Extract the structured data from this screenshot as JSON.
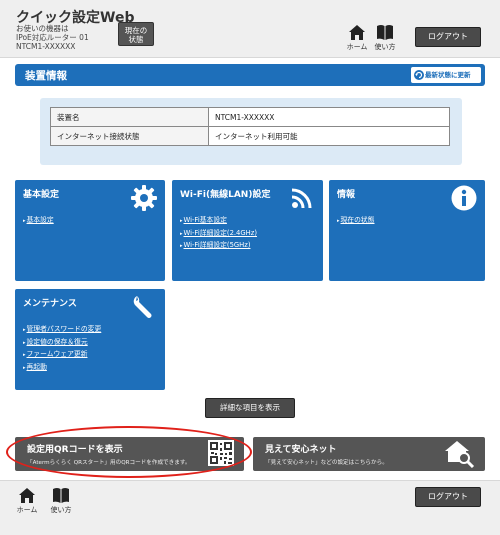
{
  "header": {
    "app_title": "クイック設定Web",
    "device_line1": "お使いの機器は",
    "device_line2": "IPoE対応ルーター 01",
    "device_line3": "NTCM1-XXXXXX",
    "status_button_line1": "現在の",
    "status_button_line2": "状態",
    "home_label": "ホーム",
    "help_label": "使い方",
    "logout_label": "ログアウト"
  },
  "device_info": {
    "title": "装置情報",
    "refresh_label": "最新状態に更新",
    "rows": [
      {
        "key": "装置名",
        "value": "NTCM1-XXXXXX"
      },
      {
        "key": "インターネット接続状態",
        "value": "インターネット利用可能"
      }
    ]
  },
  "tiles": {
    "basic": {
      "title": "基本設定",
      "icon": "gear-icon",
      "links": [
        "基本設定"
      ]
    },
    "wifi": {
      "title": "Wi-Fi(無線LAN)設定",
      "icon": "wifi-icon",
      "links": [
        "Wi-Fi基本設定",
        "Wi-Fi詳細設定(2.4GHz)",
        "Wi-Fi詳細設定(5GHz)"
      ]
    },
    "info": {
      "title": "情報",
      "icon": "info-icon",
      "links": [
        "現在の状態"
      ]
    },
    "maintenance": {
      "title": "メンテナンス",
      "icon": "wrench-icon",
      "links": [
        "管理者パスワードの変更",
        "設定値の保存＆復元",
        "ファームウェア更新",
        "再起動"
      ]
    }
  },
  "detail_button_label": "詳細な項目を表示",
  "banners": {
    "qr": {
      "title": "設定用QRコードを表示",
      "desc": "「Atermらくらく QRスタート」用のQRコードを作成できます。",
      "icon": "qr-code-icon"
    },
    "safe_net": {
      "title": "見えて安心ネット",
      "desc": "「見えて安心ネット」などの設定はこちらから。",
      "icon": "house-search-icon"
    }
  },
  "footer": {
    "home_label": "ホーム",
    "help_label": "使い方",
    "logout_label": "ログアウト"
  },
  "colors": {
    "accent": "#1e6fba",
    "highlight": "#e0211a",
    "dark_button": "#4a4a4a"
  }
}
